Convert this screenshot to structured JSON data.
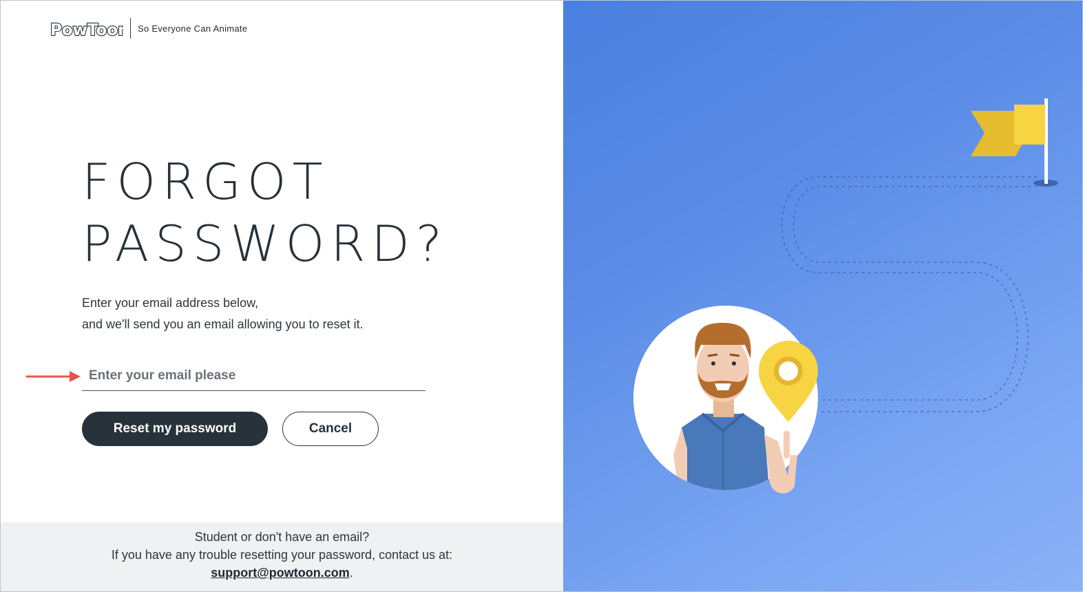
{
  "brand": {
    "logo_text": "PowToon",
    "tagline": "So Everyone Can Animate"
  },
  "page": {
    "title_line1": "FORGOT",
    "title_line2": "PASSWORD?",
    "description_line1": "Enter your email address below,",
    "description_line2": "and we'll send you an email allowing you to reset it."
  },
  "form": {
    "email_placeholder": "Enter your email please",
    "email_value": "",
    "reset_label": "Reset my password",
    "cancel_label": "Cancel"
  },
  "footer": {
    "line1": "Student or don't have an email?",
    "line2": "If you have any trouble resetting your password, contact us at:",
    "support_email": "support@powtoon.com",
    "trailing": "."
  },
  "colors": {
    "accent_dark": "#27323b",
    "panel_blue": "#5b8ce6",
    "flag_yellow": "#f5cf3d",
    "annotation_red": "#e8534a"
  },
  "icons": {
    "annotation": "red-arrow-icon",
    "flag": "flag-icon",
    "pin": "location-pin-icon"
  }
}
